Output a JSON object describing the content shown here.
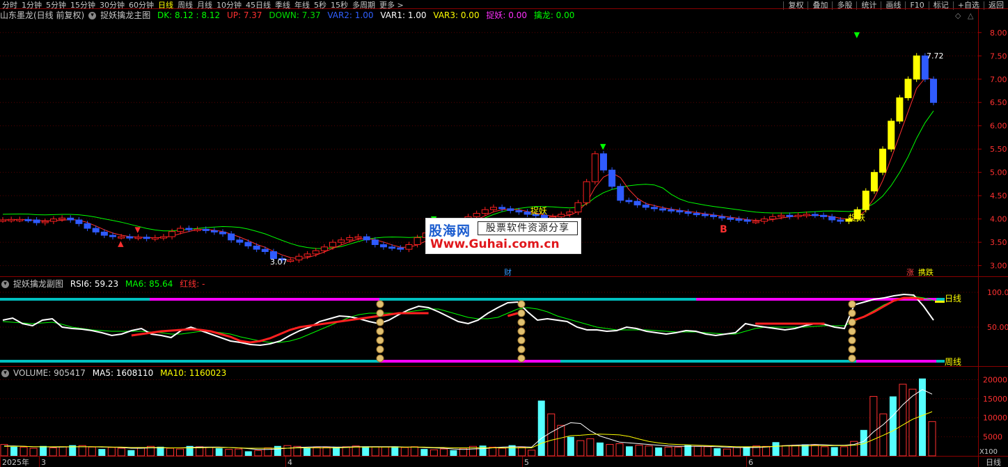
{
  "toolbar": {
    "periods": [
      "分时",
      "1分钟",
      "5分钟",
      "15分钟",
      "30分钟",
      "60分钟",
      "日线",
      "周线",
      "月线",
      "10分钟",
      "45日线",
      "季线",
      "年线",
      "5秒",
      "15秒",
      "多周期",
      "更多 >"
    ],
    "active_period": "日线",
    "right_buttons": [
      "复权",
      "叠加",
      "多股",
      "统计",
      "画线",
      "F10",
      "标记",
      "+自选",
      "返回"
    ]
  },
  "main_panel": {
    "stock": "山东墨龙(日线 前复权)",
    "indicator": "捉妖擒龙主图",
    "dk": "DK: 8.12 : 8.12",
    "up": "UP: 7.37",
    "down": "DOWN: 7.37",
    "var2": "VAR2: 1.00",
    "var1": "VAR1: 1.00",
    "var3": "VAR3: 0.00",
    "zhuoyao": "捉妖: 0.00",
    "qinlong": "擒龙: 0.00",
    "annot_low": "3.07",
    "annot_high": "7.72",
    "annot_zhuoyao1": "捉妖",
    "annot_zhuoyao2": "捉妖",
    "annot_b": "B",
    "annot_cai": "财",
    "annot_zhang": "涨",
    "annot_qiandie": "携跌"
  },
  "sub_panel": {
    "indicator": "捉妖擒龙副图",
    "rsi6": "RSI6: 59.23",
    "ma6": "MA6: 85.64",
    "hongxian": "红线: -",
    "label_daily": "日线",
    "label_weekly": "周线"
  },
  "volume_panel": {
    "volume": "VOLUME: 905417",
    "ma5": "MA5: 1608110",
    "ma10": "MA10: 1160023",
    "unit": "X100"
  },
  "x_axis": {
    "labels": [
      "2025年",
      "3",
      "4",
      "5",
      "6"
    ],
    "period_tag": "日线"
  },
  "watermark": {
    "line1": "股海网",
    "line2": "股票软件资源分享",
    "line3": "Www.Guhai.com.cn"
  },
  "chart_data": [
    {
      "type": "candlestick",
      "title": "捉妖擒龙主图",
      "y_ticks": [
        8.0,
        7.5,
        7.0,
        6.5,
        6.0,
        5.5,
        5.0,
        4.5,
        4.0,
        3.5,
        3.0
      ],
      "ylim": [
        2.8,
        8.4
      ],
      "series": [
        {
          "name": "close",
          "values": [
            3.98,
            3.99,
            3.99,
            3.98,
            3.92,
            3.95,
            4.0,
            4.02,
            3.98,
            3.9,
            3.8,
            3.72,
            3.65,
            3.62,
            3.62,
            3.6,
            3.61,
            3.58,
            3.6,
            3.62,
            3.73,
            3.8,
            3.78,
            3.78,
            3.75,
            3.72,
            3.68,
            3.55,
            3.5,
            3.42,
            3.35,
            3.3,
            3.15,
            3.12,
            3.12,
            3.2,
            3.25,
            3.32,
            3.4,
            3.5,
            3.55,
            3.6,
            3.62,
            3.55,
            3.45,
            3.4,
            3.38,
            3.35,
            3.45,
            3.6,
            3.7,
            3.8,
            3.9,
            3.88,
            3.9,
            4.05,
            4.12,
            4.2,
            4.25,
            4.22,
            4.18,
            4.15,
            4.1,
            4.08,
            4.02,
            4.05,
            4.1,
            4.15,
            4.35,
            4.8,
            5.4,
            5.05,
            4.7,
            4.4,
            4.38,
            4.3,
            4.25,
            4.22,
            4.2,
            4.18,
            4.15,
            4.12,
            4.1,
            4.08,
            4.05,
            4.02,
            4.0,
            3.98,
            3.95,
            3.95,
            4.0,
            4.05,
            4.08,
            4.05,
            4.08,
            4.1,
            4.08,
            4.05,
            3.98,
            3.95,
            4.0,
            4.2,
            4.6,
            5.0,
            5.5,
            6.1,
            6.6,
            7.0,
            7.5,
            7.0,
            6.5
          ]
        }
      ]
    },
    {
      "type": "line",
      "title": "捉妖擒龙副图",
      "y_ticks": [
        100,
        50
      ],
      "ylim": [
        0,
        110
      ],
      "series": [
        {
          "name": "RSI6",
          "values": [
            60,
            63,
            55,
            52,
            60,
            62,
            50,
            48,
            47,
            45,
            42,
            38,
            40,
            45,
            48,
            40,
            38,
            35,
            45,
            50,
            45,
            40,
            35,
            30,
            28,
            25,
            24,
            26,
            30,
            38,
            45,
            50,
            58,
            62,
            66,
            65,
            62,
            58,
            55,
            60,
            68,
            75,
            80,
            78,
            72,
            65,
            58,
            55,
            60,
            70,
            78,
            85,
            86,
            72,
            60,
            62,
            60,
            58,
            50,
            46,
            46,
            44,
            45,
            50,
            48,
            44,
            42,
            40,
            42,
            45,
            44,
            40,
            38,
            40,
            42,
            55,
            52,
            50,
            48,
            46,
            48,
            52,
            55,
            54,
            50,
            48,
            82,
            86,
            90,
            92,
            95,
            97,
            96,
            80,
            60
          ]
        },
        {
          "name": "MA6",
          "values": [
            58,
            57,
            56,
            55,
            56,
            57,
            54,
            50,
            48,
            46,
            45,
            44,
            44,
            44,
            44,
            43,
            42,
            40,
            40,
            42,
            44,
            44,
            42,
            40,
            36,
            33,
            30,
            28,
            28,
            30,
            34,
            40,
            46,
            52,
            58,
            64,
            68,
            70,
            70,
            70,
            70,
            72,
            74,
            76,
            76,
            72,
            68,
            64,
            62,
            62,
            64,
            70,
            76,
            78,
            76,
            72,
            66,
            62,
            58,
            54,
            50,
            48,
            46,
            46,
            46,
            46,
            45,
            44,
            43,
            43,
            43,
            42,
            41,
            40,
            40,
            44,
            48,
            50,
            50,
            50,
            50,
            50,
            51,
            52,
            52,
            52,
            58,
            66,
            74,
            82,
            88,
            92,
            94,
            92,
            88
          ]
        },
        {
          "name": "红线",
          "values": [
            null,
            null,
            null,
            null,
            null,
            null,
            null,
            null,
            null,
            null,
            null,
            null,
            null,
            38,
            40,
            42,
            44,
            45,
            46,
            47,
            46,
            44,
            40,
            36,
            30,
            28,
            30,
            34,
            40,
            46,
            50,
            52,
            54,
            56,
            58,
            60,
            62,
            64,
            66,
            68,
            70,
            70,
            70,
            70,
            null,
            null,
            null,
            null,
            null,
            null,
            null,
            66,
            70,
            null,
            null,
            null,
            null,
            null,
            null,
            null,
            null,
            null,
            null,
            null,
            null,
            null,
            null,
            null,
            null,
            null,
            null,
            null,
            null,
            null,
            null,
            null,
            55,
            55,
            55,
            55,
            55,
            55,
            55,
            55,
            null,
            null,
            60,
            65,
            72,
            80,
            88,
            92,
            92,
            90,
            null
          ]
        }
      ]
    },
    {
      "type": "bar",
      "title": "VOLUME",
      "y_ticks": [
        20000,
        15000,
        10000,
        5000
      ],
      "ylim": [
        0,
        21000
      ],
      "unit": "X100",
      "series": [
        {
          "name": "VOLUME",
          "values": [
            3000,
            2400,
            2300,
            2000,
            2600,
            2100,
            2400,
            2800,
            2700,
            2300,
            1800,
            2200,
            2000,
            1500,
            2200,
            2500,
            2400,
            2000,
            1800,
            2600,
            2400,
            2200,
            2000,
            1700,
            1800,
            1200,
            1400,
            2100,
            2600,
            2700,
            2500,
            2000,
            2200,
            2300,
            2300,
            2400,
            2600,
            2500,
            2400,
            2300,
            2500,
            2200,
            2400,
            1800,
            1600,
            1800,
            1500,
            2000,
            2500,
            2700,
            2300,
            2000,
            2800,
            2200,
            1500,
            14500,
            11000,
            8000,
            5000,
            4000,
            4500,
            3500,
            3000,
            3200,
            2500,
            2800,
            2600,
            2200,
            2300,
            2300,
            2800,
            2500,
            2400,
            2000,
            1800,
            2200,
            2400,
            2600,
            2500,
            3600,
            2700,
            2800,
            3000,
            2800,
            2400,
            2300,
            2400,
            3800,
            6800,
            15600,
            11000,
            15600,
            18800,
            17500,
            20300,
            9000
          ]
        },
        {
          "name": "MA5",
          "values": [
            2600,
            2600,
            2500,
            2400,
            2400,
            2300,
            2300,
            2400,
            2400,
            2400,
            2300,
            2300,
            2200,
            2000,
            2000,
            2100,
            2100,
            2100,
            2100,
            2200,
            2300,
            2300,
            2300,
            2200,
            2100,
            1900,
            1700,
            1700,
            1800,
            2000,
            2200,
            2300,
            2400,
            2400,
            2300,
            2300,
            2400,
            2400,
            2400,
            2400,
            2400,
            2300,
            2300,
            2200,
            2100,
            2000,
            1800,
            1700,
            1800,
            1900,
            2100,
            2300,
            2400,
            2400,
            2300,
            4600,
            6200,
            7600,
            8700,
            8500,
            6600,
            5200,
            4400,
            3600,
            3400,
            3200,
            3000,
            2800,
            2600,
            2500,
            2500,
            2500,
            2500,
            2400,
            2300,
            2200,
            2200,
            2200,
            2300,
            2500,
            2700,
            2800,
            2900,
            3000,
            2900,
            2800,
            2800,
            3000,
            3800,
            6300,
            8200,
            10600,
            13400,
            15700,
            17400,
            16200
          ]
        },
        {
          "name": "MA10",
          "values": [
            2500,
            2500,
            2500,
            2400,
            2400,
            2400,
            2400,
            2400,
            2400,
            2400,
            2400,
            2300,
            2300,
            2200,
            2200,
            2200,
            2200,
            2100,
            2100,
            2100,
            2100,
            2200,
            2200,
            2200,
            2100,
            2000,
            2000,
            2000,
            2000,
            2000,
            2100,
            2100,
            2100,
            2100,
            2100,
            2200,
            2300,
            2300,
            2300,
            2300,
            2300,
            2300,
            2300,
            2300,
            2200,
            2200,
            2100,
            2100,
            2100,
            2100,
            2100,
            2100,
            2100,
            2100,
            2100,
            3300,
            4100,
            4700,
            5300,
            5400,
            5600,
            5700,
            5600,
            5500,
            5100,
            4400,
            3800,
            3400,
            3100,
            3000,
            2900,
            2800,
            2700,
            2600,
            2500,
            2400,
            2400,
            2400,
            2400,
            2500,
            2600,
            2600,
            2600,
            2700,
            2700,
            2700,
            2700,
            2800,
            3200,
            4300,
            5400,
            6600,
            8100,
            9600,
            10600,
            11600
          ]
        }
      ]
    }
  ]
}
